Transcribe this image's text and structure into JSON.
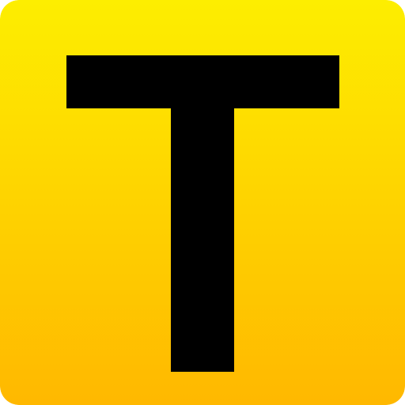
{
  "icon": {
    "name": "letter-t-app-icon",
    "letter": "T",
    "colors": {
      "gradient_top": "#FDEE00",
      "gradient_bottom": "#FFB800",
      "glyph": "#000000"
    }
  }
}
